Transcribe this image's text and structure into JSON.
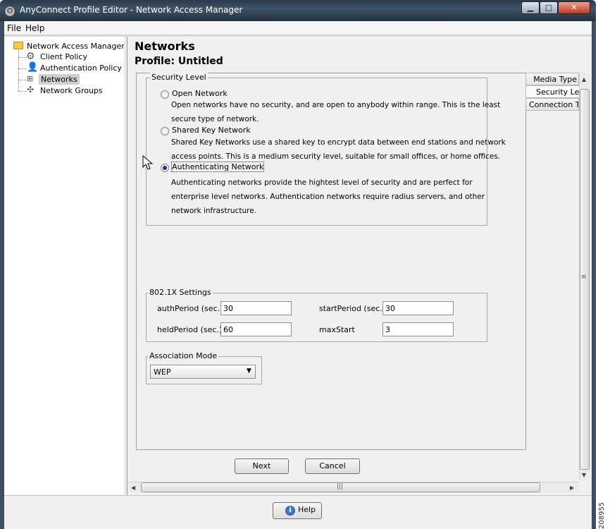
{
  "window": {
    "title": "AnyConnect Profile Editor - Network Access Manager"
  },
  "menubar": {
    "file": "File",
    "help": "Help"
  },
  "tree": {
    "root": "Network Access Manager",
    "items": [
      {
        "label": "Client Policy",
        "icon": "gear-icon"
      },
      {
        "label": "Authentication Policy",
        "icon": "user-key-icon"
      },
      {
        "label": "Networks",
        "icon": "network-icon",
        "selected": true
      },
      {
        "label": "Network Groups",
        "icon": "network-group-icon"
      }
    ]
  },
  "header": {
    "title": "Networks",
    "profile": "Profile:  Untitled"
  },
  "security_level": {
    "legend": "Security Level",
    "options": [
      {
        "label": "Open Network",
        "selected": false,
        "desc": [
          "Open networks have no security, and are open to anybody within range.  This is the least",
          "secure type of network."
        ]
      },
      {
        "label": "Shared Key Network",
        "selected": false,
        "desc": [
          "Shared Key Networks use a shared key to encrypt data between end stations and network",
          "access points.  This is a medium security level, suitable for small offices, or home offices."
        ]
      },
      {
        "label": "Authenticating Network",
        "selected": true,
        "desc": [
          "Authenticating networks provide the hightest level of security and are perfect for",
          "enterprise level networks.  Authentication networks require radius servers, and other",
          "network infrastructure."
        ]
      }
    ]
  },
  "dot1x": {
    "legend": "802.1X Settings",
    "auth_period_label": "authPeriod (sec.)",
    "auth_period": "30",
    "start_period_label": "startPeriod (sec.)",
    "start_period": "30",
    "held_period_label": "heldPeriod (sec.)",
    "held_period": "60",
    "max_start_label": "maxStart",
    "max_start": "3"
  },
  "association": {
    "legend": "Association Mode",
    "value": "WEP"
  },
  "side_tabs": [
    "Media Type",
    "Security Level",
    "Connection Type"
  ],
  "buttons": {
    "next": "Next",
    "cancel": "Cancel",
    "help": "Help"
  },
  "side_number": "208955"
}
